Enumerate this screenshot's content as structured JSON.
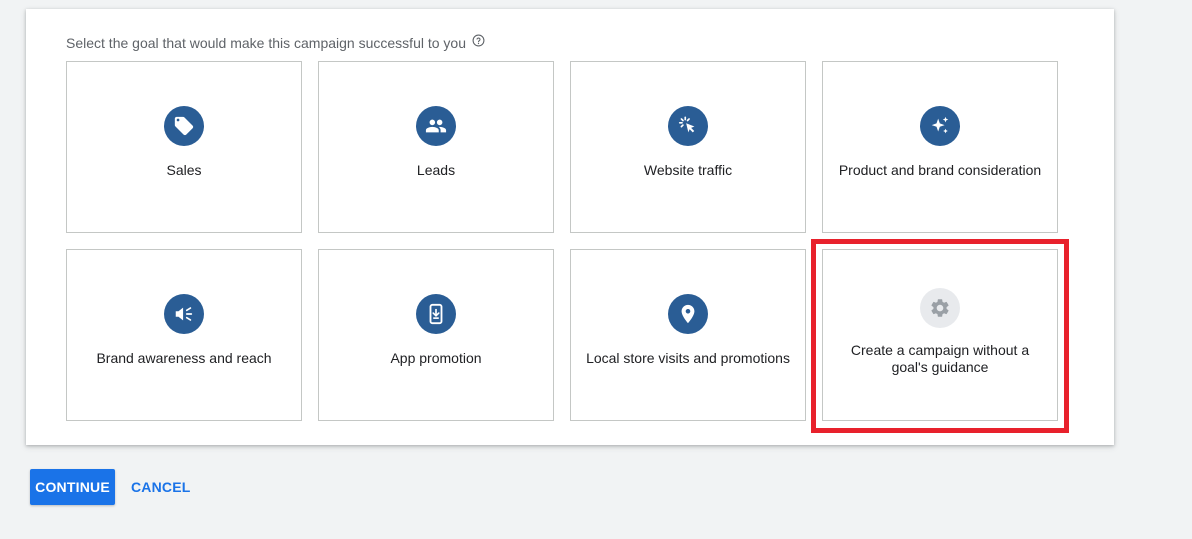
{
  "prompt": {
    "text": "Select the goal that would make this campaign successful to you",
    "help_icon": "help-circle-icon"
  },
  "goals": [
    {
      "label": "Sales",
      "icon": "tag-icon"
    },
    {
      "label": "Leads",
      "icon": "people-icon"
    },
    {
      "label": "Website traffic",
      "icon": "cursor-click-icon"
    },
    {
      "label": "Product and brand consideration",
      "icon": "sparkle-icon"
    },
    {
      "label": "Brand awareness and reach",
      "icon": "megaphone-icon"
    },
    {
      "label": "App promotion",
      "icon": "phone-download-icon"
    },
    {
      "label": "Local store visits and promotions",
      "icon": "location-pin-icon"
    },
    {
      "label": "Create a campaign without a goal's guidance",
      "icon": "gear-icon"
    }
  ],
  "buttons": {
    "continue": "CONTINUE",
    "cancel": "CANCEL"
  },
  "colors": {
    "icon_bg": "#2a5d95",
    "icon_bg_neutral": "#e8eaed",
    "primary": "#1a73e8",
    "highlight": "#e8212c",
    "page_bg": "#f1f3f4"
  }
}
